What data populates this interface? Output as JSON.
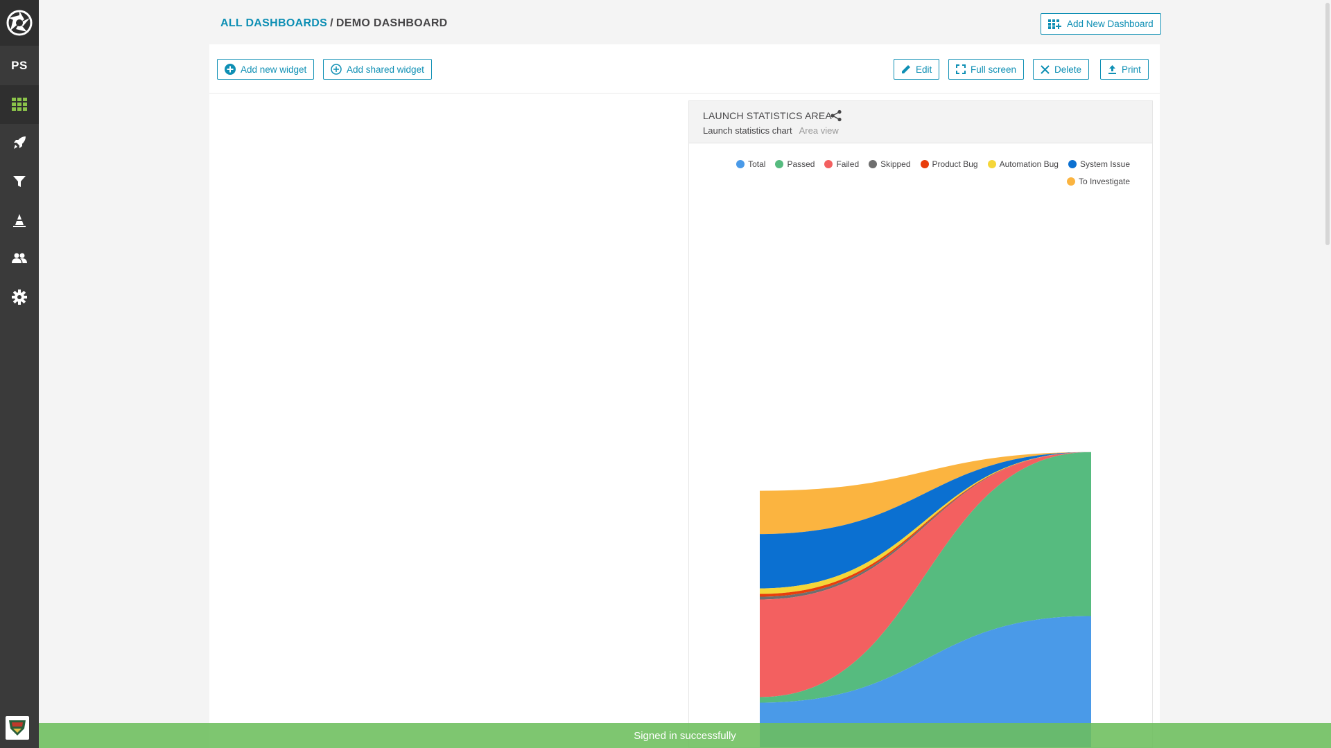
{
  "sidebar": {
    "project_label": "PS",
    "items": [
      {
        "name": "dashboards",
        "icon": "grid-icon",
        "active": true
      },
      {
        "name": "launches",
        "icon": "rocket-icon",
        "active": false
      },
      {
        "name": "filters",
        "icon": "filter-icon",
        "active": false
      },
      {
        "name": "debug",
        "icon": "cone-icon",
        "active": false
      },
      {
        "name": "members",
        "icon": "members-icon",
        "active": false
      },
      {
        "name": "settings",
        "icon": "gear-icon",
        "active": false
      }
    ]
  },
  "header": {
    "breadcrumb_root": "ALL DASHBOARDS",
    "breadcrumb_sep": "/",
    "breadcrumb_current": "DEMO DASHBOARD",
    "add_dashboard_label": "Add New Dashboard"
  },
  "toolbar": {
    "add_widget_label": "Add new widget",
    "add_shared_label": "Add shared widget",
    "edit_label": "Edit",
    "fullscreen_label": "Full screen",
    "delete_label": "Delete",
    "print_label": "Print"
  },
  "widget": {
    "title": "LAUNCH STATISTICS AREA",
    "type_label": "Launch statistics chart",
    "view_label": "Area view"
  },
  "chart_data": {
    "type": "area",
    "stacked": true,
    "legend_position": "top-right",
    "grid": false,
    "series": [
      {
        "name": "Total",
        "color": "#4a9ae8",
        "values": [
          50,
          144
        ]
      },
      {
        "name": "Passed",
        "color": "#56bb7f",
        "values": [
          6,
          178
        ]
      },
      {
        "name": "Failed",
        "color": "#f36060",
        "values": [
          106,
          0
        ]
      },
      {
        "name": "Skipped",
        "color": "#6e6e6e",
        "values": [
          3,
          0
        ]
      },
      {
        "name": "Product Bug",
        "color": "#e83d0b",
        "values": [
          3,
          0
        ]
      },
      {
        "name": "Automation Bug",
        "color": "#f5d639",
        "values": [
          6,
          0
        ]
      },
      {
        "name": "System Issue",
        "color": "#0b70d1",
        "values": [
          59,
          0
        ]
      },
      {
        "name": "To Investigate",
        "color": "#fbb440",
        "values": [
          47,
          0
        ]
      }
    ]
  },
  "toast": {
    "message": "Signed in successfully",
    "color": "#6cbe5c"
  },
  "colors": {
    "accent": "#0e8fb4",
    "sidebar_bg": "#3a3a3a",
    "sidebar_active_icon": "#8bc34a"
  }
}
